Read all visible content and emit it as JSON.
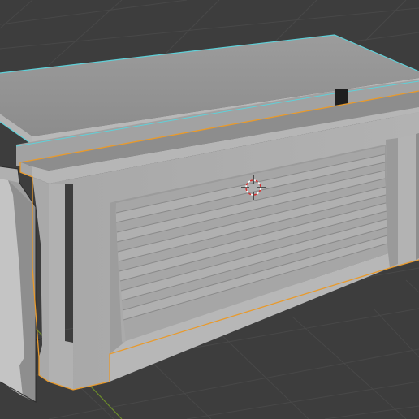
{
  "viewport": {
    "mode": "3d-viewport",
    "colors": {
      "background": "#3d3d3d",
      "grid_line": "#4a4a4a",
      "axis_x": "#8b3d3d",
      "axis_y": "#6b8b2a",
      "selected_active_outline": "#e89a2c",
      "selected_outline": "#5fd0d8",
      "mesh_light": "#a9a9a9",
      "mesh_mid": "#8f8f8f",
      "mesh_dark": "#707070"
    },
    "objects": [
      {
        "name": "roof-slab",
        "state": "selected"
      },
      {
        "name": "garage-front",
        "state": "active"
      },
      {
        "name": "left-pillar",
        "state": "unselected"
      }
    ],
    "cursor_icon": "3d-cursor-icon"
  }
}
